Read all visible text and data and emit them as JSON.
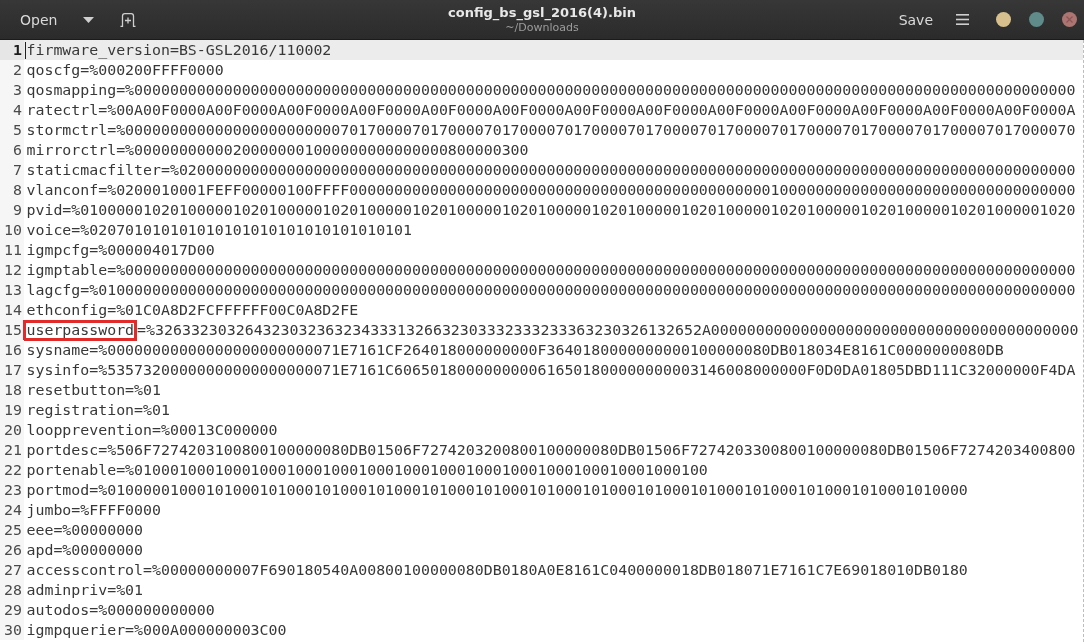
{
  "header_bar": {
    "open_button": "Open",
    "title": "config_bs_gsl_2016(4).bin",
    "subtitle": "~/Downloads",
    "save_button": "Save"
  },
  "editor": {
    "lines": [
      {
        "number": "1",
        "current": true,
        "segments": [
          {
            "text": "firmware_version=BS-GSL2016/110002",
            "boxed": false
          }
        ]
      },
      {
        "number": "2",
        "current": false,
        "segments": [
          {
            "text": "qoscfg=%000200FFFF0000",
            "boxed": false
          }
        ]
      },
      {
        "number": "3",
        "current": false,
        "segments": [
          {
            "text": "qosmapping=%000000000000000000000000000000000000000000000000000000000000000000000000000000000000000000000000000000000",
            "boxed": false
          }
        ]
      },
      {
        "number": "4",
        "current": false,
        "segments": [
          {
            "text": "ratectrl=%00A00F0000A00F0000A00F0000A00F0000A00F0000A00F0000A00F0000A00F0000A00F0000A00F0000A00F0000A00F0000A00F0000A",
            "boxed": false
          }
        ]
      },
      {
        "number": "5",
        "current": false,
        "segments": [
          {
            "text": "stormctrl=%0000000000000000000000007017000070170000701700007017000070170000701700007017000070170000701700007017000070",
            "boxed": false
          }
        ]
      },
      {
        "number": "6",
        "current": false,
        "segments": [
          {
            "text": "mirrorctrl=%00000000000200000001000000000000000800000300",
            "boxed": false
          }
        ]
      },
      {
        "number": "7",
        "current": false,
        "segments": [
          {
            "text": "staticmacfilter=%0200000000000000000000000000000000000000000000000000000000000000000000000000000000000000000000000000",
            "boxed": false
          }
        ]
      },
      {
        "number": "8",
        "current": false,
        "segments": [
          {
            "text": "vlanconf=%0200010001FEFF00000100FFFF000000000000000000000000000000000000000000000001000000000000000000000000000000000",
            "boxed": false
          }
        ]
      },
      {
        "number": "9",
        "current": false,
        "segments": [
          {
            "text": "pvid=%010000010201000001020100000102010000010201000001020100000102010000010201000001020100000102010000010201000001020",
            "boxed": false
          }
        ]
      },
      {
        "number": "10",
        "current": false,
        "segments": [
          {
            "text": "voice=%020701010101010101010101010101010101",
            "boxed": false
          }
        ]
      },
      {
        "number": "11",
        "current": false,
        "segments": [
          {
            "text": "igmpcfg=%000004017D00",
            "boxed": false
          }
        ]
      },
      {
        "number": "12",
        "current": false,
        "segments": [
          {
            "text": "igmptable=%0000000000000000000000000000000000000000000000000000000000000000000000000000000000000000000000000000000000",
            "boxed": false
          }
        ]
      },
      {
        "number": "13",
        "current": false,
        "segments": [
          {
            "text": "lagcfg=%0100000000000000000000000000000000000000000000000000000000000000000000000000000000000000000000000000000000000",
            "boxed": false
          }
        ]
      },
      {
        "number": "14",
        "current": false,
        "segments": [
          {
            "text": "ethconfig=%01C0A8D2FCFFFFFF00C0A8D2FE",
            "boxed": false
          }
        ]
      },
      {
        "number": "15",
        "current": false,
        "segments": [
          {
            "text": "userpassword",
            "boxed": true
          },
          {
            "text": "=%3263323032643230323632343331326632303332333233363230326132652A00000000000000000000000000000000000000000",
            "boxed": false
          }
        ]
      },
      {
        "number": "16",
        "current": false,
        "segments": [
          {
            "text": "sysname=%00000000000000000000000071E7161CF264018000000000F3640180000000000100000080DB018034E8161C0000000080DB",
            "boxed": false
          }
        ]
      },
      {
        "number": "17",
        "current": false,
        "segments": [
          {
            "text": "sysinfo=%53573200000000000000000071E7161C6065018000000000616501800000000003146008000000F0D0DA01805DBD111C32000000F4DA",
            "boxed": false
          }
        ]
      },
      {
        "number": "18",
        "current": false,
        "segments": [
          {
            "text": "resetbutton=%01",
            "boxed": false
          }
        ]
      },
      {
        "number": "19",
        "current": false,
        "segments": [
          {
            "text": "registration=%01",
            "boxed": false
          }
        ]
      },
      {
        "number": "20",
        "current": false,
        "segments": [
          {
            "text": "loopprevention=%00013C000000",
            "boxed": false
          }
        ]
      },
      {
        "number": "21",
        "current": false,
        "segments": [
          {
            "text": "portdesc=%506F7274203100800100000080DB01506F7274203200800100000080DB01506F7274203300800100000080DB01506F7274203400800",
            "boxed": false
          }
        ]
      },
      {
        "number": "22",
        "current": false,
        "segments": [
          {
            "text": "portenable=%0100010001000100010001000100010001000100010001000100010001000100",
            "boxed": false
          }
        ]
      },
      {
        "number": "23",
        "current": false,
        "segments": [
          {
            "text": "portmod=%010000010001010001010001010001010001010001010001010001010001010001010001010001010001010001010000",
            "boxed": false
          }
        ]
      },
      {
        "number": "24",
        "current": false,
        "segments": [
          {
            "text": "jumbo=%FFFF0000",
            "boxed": false
          }
        ]
      },
      {
        "number": "25",
        "current": false,
        "segments": [
          {
            "text": "eee=%00000000",
            "boxed": false
          }
        ]
      },
      {
        "number": "26",
        "current": false,
        "segments": [
          {
            "text": "apd=%00000000",
            "boxed": false
          }
        ]
      },
      {
        "number": "27",
        "current": false,
        "segments": [
          {
            "text": "accesscontrol=%00000000007F690180540A00800100000080DB0180A0E8161C0400000018DB018071E7161C7E69018010DB0180",
            "boxed": false
          }
        ]
      },
      {
        "number": "28",
        "current": false,
        "segments": [
          {
            "text": "adminpriv=%01",
            "boxed": false
          }
        ]
      },
      {
        "number": "29",
        "current": false,
        "segments": [
          {
            "text": "autodos=%000000000000",
            "boxed": false
          }
        ]
      },
      {
        "number": "30",
        "current": false,
        "segments": [
          {
            "text": "igmpquerier=%000A000000003C00",
            "boxed": false
          }
        ]
      }
    ]
  }
}
